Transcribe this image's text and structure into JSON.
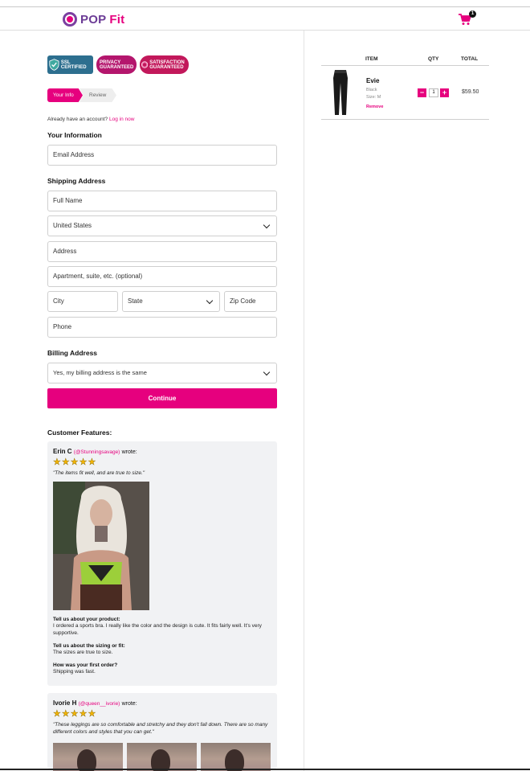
{
  "brand": {
    "name_pop": "POP",
    "name_fit": "Fit"
  },
  "cart": {
    "count": "1"
  },
  "badges": [
    "SSL CERTIFIED",
    "PRIVACY GUARANTEED",
    "SATISFACTION GUARANTEED"
  ],
  "steps": {
    "active": "Your Info",
    "next": "Review"
  },
  "account": {
    "prompt": "Already have an account?",
    "login": "Log in now"
  },
  "your_info": {
    "title": "Your Information",
    "email_placeholder": "Email Address"
  },
  "shipping": {
    "title": "Shipping Address",
    "full_name": "Full Name",
    "country": "United States",
    "address": "Address",
    "apartment": "Apartment, suite, etc. (optional)",
    "city": "City",
    "state": "State",
    "zip": "Zip Code",
    "phone": "Phone"
  },
  "billing": {
    "title": "Billing Address",
    "option": "Yes, my billing address is the same"
  },
  "continue_label": "Continue",
  "features": {
    "title": "Customer Features:",
    "reviews": [
      {
        "name": "Erin C",
        "handle": "(@Stunningsavage)",
        "wrote": "wrote:",
        "stars": 5,
        "quote": "\"The items fit well, and are true to size.\"",
        "q1": "Tell us about your product:",
        "a1": "I ordered a sports bra. I really like the color and the design is cute. It fits fairly well. It's very supportive.",
        "q2": "Tell us about the sizing or fit:",
        "a2": "The sizes are true to size.",
        "q3": "How was your first order?",
        "a3": "Shipping was fast."
      },
      {
        "name": "Ivorie H",
        "handle": "(@queen__ivorie)",
        "wrote": "wrote:",
        "stars": 5,
        "quote": "\"These leggings are so comfortable and stretchy and they don't fall down. There are so many different colors and styles that you can get.\""
      }
    ]
  },
  "order": {
    "headers": {
      "item": "ITEM",
      "qty": "QTY",
      "total": "TOTAL"
    },
    "product": {
      "name": "Evie",
      "color": "Black",
      "size": "Size: M",
      "remove": "Remove",
      "quantity": "1",
      "minus": "−",
      "plus": "+",
      "price": "$59.50"
    }
  },
  "colors": {
    "accent": "#e6007e",
    "brand_purple": "#6c3c96"
  }
}
